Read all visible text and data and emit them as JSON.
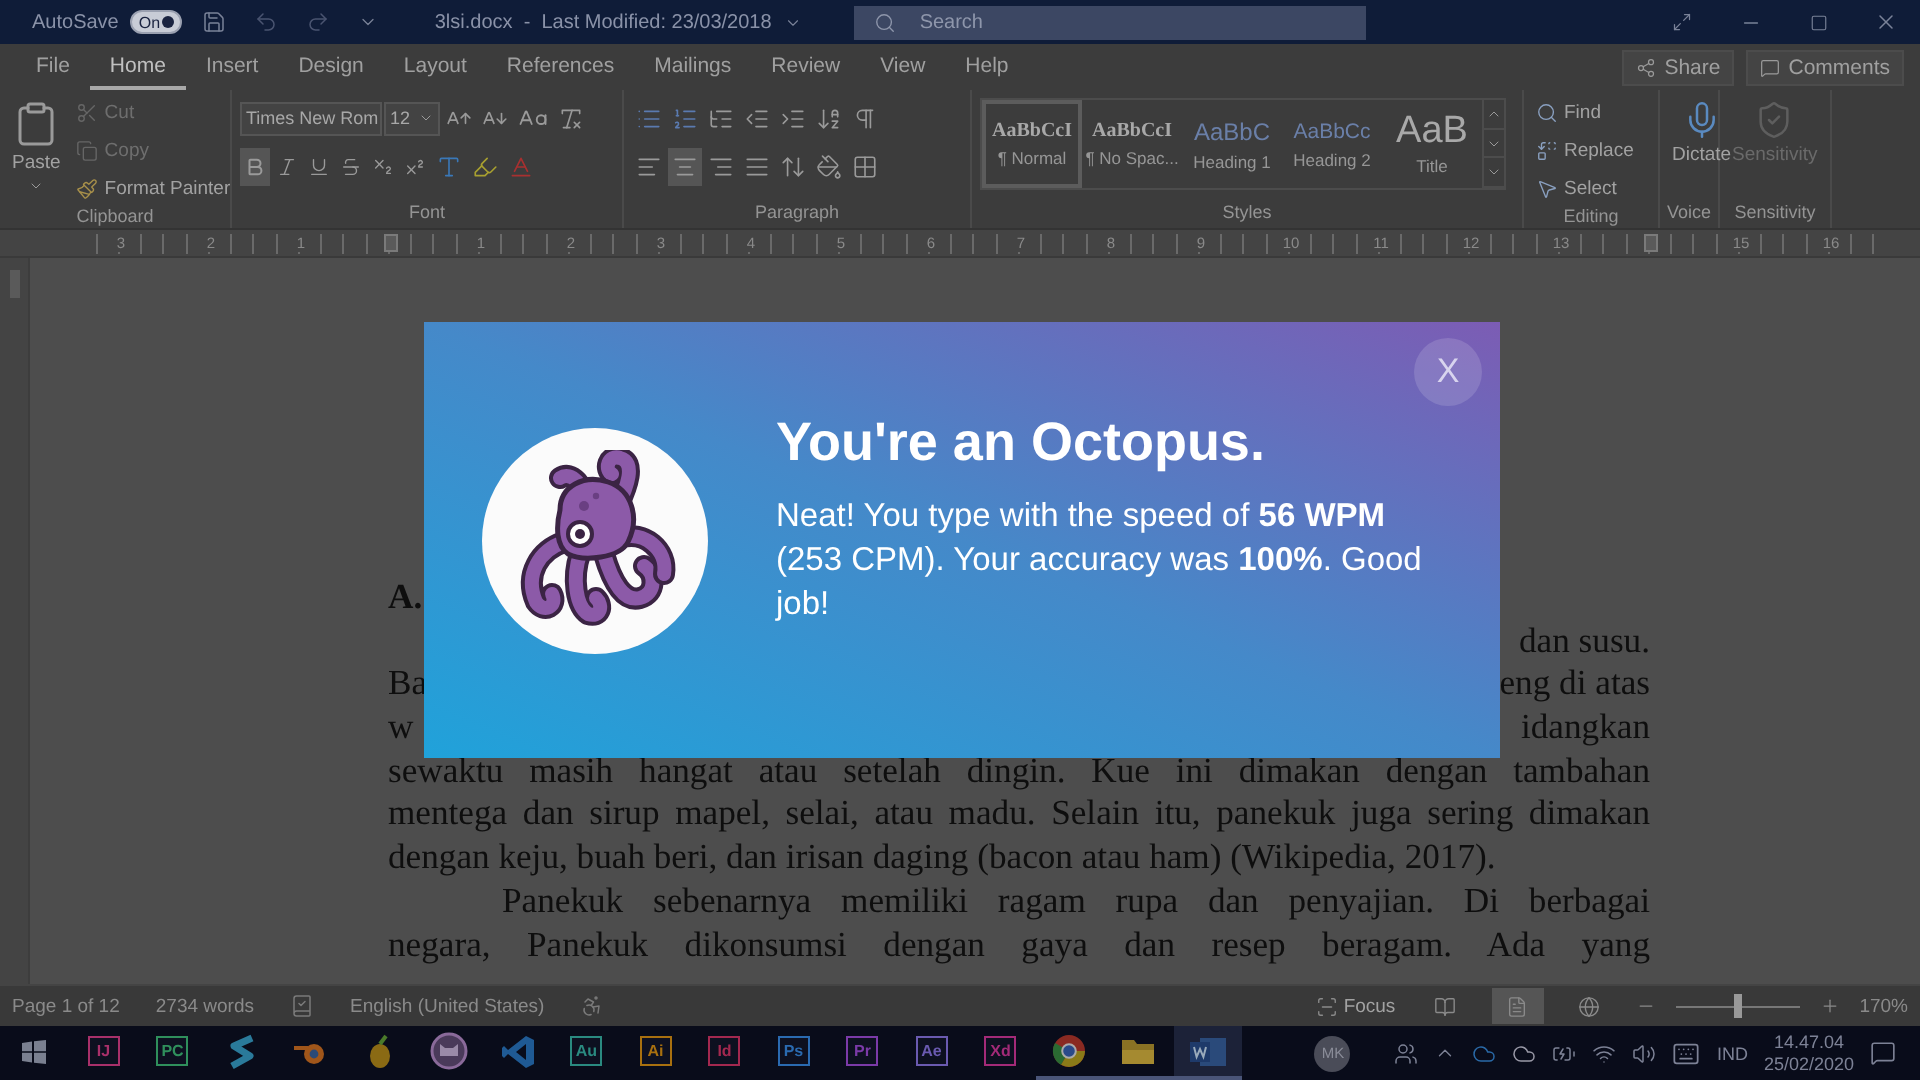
{
  "title_bar": {
    "autosave_label": "AutoSave",
    "autosave": {
      "label": "On",
      "on": true
    },
    "document_title": "3lsi.docx  -  Last Modified: 23/03/2018",
    "search": {
      "placeholder": "Search"
    }
  },
  "menu_tabs": [
    {
      "label": "File",
      "selected": false
    },
    {
      "label": "Home",
      "selected": true
    },
    {
      "label": "Insert",
      "selected": false
    },
    {
      "label": "Design",
      "selected": false
    },
    {
      "label": "Layout",
      "selected": false
    },
    {
      "label": "References",
      "selected": false
    },
    {
      "label": "Mailings",
      "selected": false
    },
    {
      "label": "Review",
      "selected": false
    },
    {
      "label": "View",
      "selected": false
    },
    {
      "label": "Help",
      "selected": false
    }
  ],
  "share": "Share",
  "comments": "Comments",
  "clipboard": {
    "paste": "Paste",
    "actions": [
      {
        "kind": "cut",
        "label": "Cut",
        "disabled": true
      },
      {
        "kind": "copy",
        "label": "Copy",
        "disabled": true
      },
      {
        "kind": "painter",
        "label": "Format Painter",
        "disabled": false
      }
    ],
    "label": "Clipboard"
  },
  "font": {
    "font_name": "Times New Rom",
    "font_size": "12",
    "bold": true,
    "label": "Font"
  },
  "paragraph": {
    "alignments": [
      {
        "kind": "left",
        "selected": false
      },
      {
        "kind": "center",
        "selected": true
      },
      {
        "kind": "right",
        "selected": false
      },
      {
        "kind": "justify",
        "selected": false
      }
    ],
    "label": "Paragraph"
  },
  "styles": {
    "items": [
      {
        "kind": "serif",
        "preview": "AaBbCcI",
        "name": "¶ Normal",
        "selected": true
      },
      {
        "kind": "serif",
        "preview": "AaBbCcI",
        "name": "¶ No Spac...",
        "selected": false
      },
      {
        "kind": "heading1",
        "preview": "AaBbC",
        "name": "Heading 1",
        "selected": false
      },
      {
        "kind": "heading2",
        "preview": "AaBbCc",
        "name": "Heading 2",
        "selected": false
      },
      {
        "kind": "title",
        "preview": "AaB",
        "name": "Title",
        "selected": false
      }
    ],
    "label": "Styles"
  },
  "editing": {
    "actions": [
      {
        "kind": "find",
        "label": "Find"
      },
      {
        "kind": "replace",
        "label": "Replace"
      },
      {
        "kind": "select",
        "label": "Select"
      }
    ],
    "label": "Editing"
  },
  "voice": {
    "button": "Dictate",
    "label": "Voice"
  },
  "sensitivity": {
    "button": "Sensitivity",
    "disabled": true,
    "label": "Sensitivity"
  },
  "ruler": {
    "marks": [
      {
        "kind": "number",
        "text": "3"
      },
      {
        "kind": "number",
        "text": "2"
      },
      {
        "kind": "number",
        "text": "1"
      },
      {
        "kind": "indent"
      },
      {
        "kind": "number",
        "text": "1"
      },
      {
        "kind": "number",
        "text": "2"
      },
      {
        "kind": "number",
        "text": "3"
      },
      {
        "kind": "number",
        "text": "4"
      },
      {
        "kind": "number",
        "text": "5"
      },
      {
        "kind": "number",
        "text": "6"
      },
      {
        "kind": "number",
        "text": "7"
      },
      {
        "kind": "number",
        "text": "8"
      },
      {
        "kind": "number",
        "text": "9"
      },
      {
        "kind": "number",
        "text": "10"
      },
      {
        "kind": "number",
        "text": "11"
      },
      {
        "kind": "number",
        "text": "12"
      },
      {
        "kind": "number",
        "text": "13"
      },
      {
        "kind": "right_indent"
      },
      {
        "kind": "number",
        "text": "15"
      },
      {
        "kind": "number",
        "text": "16"
      }
    ]
  },
  "document": {
    "lines": [
      {
        "kind": "heading",
        "text": "A."
      },
      {
        "kind": "split",
        "right": "dan susu."
      },
      {
        "kind": "split",
        "left": "Ba",
        "right": "eng di atas"
      },
      {
        "kind": "split",
        "left": "w",
        "right": "idangkan"
      },
      {
        "kind": "line",
        "text": "sewaktu masih hangat atau setelah dingin. Kue ini dimakan dengan tambahan"
      },
      {
        "kind": "line",
        "text": "mentega dan sirup mapel, selai, atau madu. Selain itu, panekuk juga sering dimakan"
      },
      {
        "kind": "last",
        "text": "dengan keju, buah beri, dan irisan daging (bacon atau ham) (Wikipedia, 2017)."
      },
      {
        "kind": "indent",
        "text": "Panekuk sebenarnya memiliki ragam rupa dan penyajian. Di berbagai"
      },
      {
        "kind": "line",
        "text": "negara, Panekuk dikonsumsi dengan gaya dan resep beragam. Ada yang"
      }
    ]
  },
  "modal": {
    "title": "You're an Octopus.",
    "message": "Neat! You type with the speed of **56 WPM** (253 CPM). Your accuracy was **100%**. Good job!",
    "close": "X"
  },
  "status_bar": {
    "page": "Page 1 of 12",
    "words": "2734 words",
    "language": "English (United States)",
    "focus": "Focus",
    "views": [
      {
        "kind": "read",
        "selected": false
      },
      {
        "kind": "print",
        "selected": true
      },
      {
        "kind": "web",
        "selected": false
      }
    ],
    "zoom": {
      "level": 0.5,
      "reading": "170%"
    }
  },
  "taskbar": {
    "apps": [
      {
        "kind": "tile",
        "label": "IJ",
        "color": "#a8306a",
        "running": false,
        "selected": false
      },
      {
        "kind": "tile",
        "label": "PC",
        "color": "#2f8f5c",
        "running": false,
        "selected": false
      },
      {
        "kind": "s-logo",
        "running": false,
        "selected": false
      },
      {
        "kind": "blender",
        "running": false,
        "selected": false
      },
      {
        "kind": "fruit",
        "running": false,
        "selected": false
      },
      {
        "kind": "cat",
        "running": false,
        "selected": false
      },
      {
        "kind": "vscode",
        "running": false,
        "selected": false
      },
      {
        "kind": "tile",
        "label": "Au",
        "color": "#2a8a80",
        "running": false,
        "selected": false
      },
      {
        "kind": "tile",
        "label": "Ai",
        "color": "#a8700f",
        "running": false,
        "selected": false
      },
      {
        "kind": "tile",
        "label": "Id",
        "color": "#a3284f",
        "running": false,
        "selected": false
      },
      {
        "kind": "tile",
        "label": "Ps",
        "color": "#2a6ab0",
        "running": false,
        "selected": false
      },
      {
        "kind": "tile",
        "label": "Pr",
        "color": "#7b3aa8",
        "running": false,
        "selected": false
      },
      {
        "kind": "tile",
        "label": "Ae",
        "color": "#6a5ab0",
        "running": false,
        "selected": false
      },
      {
        "kind": "tile",
        "label": "Xd",
        "color": "#a32a78",
        "running": false,
        "selected": false
      },
      {
        "kind": "chrome",
        "running": true,
        "selected": false
      },
      {
        "kind": "folder",
        "running": true,
        "selected": false
      },
      {
        "kind": "word",
        "running": true,
        "selected": true
      }
    ],
    "avatar": "MK",
    "language": "IND",
    "time": "14.47.04",
    "date": "25/02/2020"
  }
}
